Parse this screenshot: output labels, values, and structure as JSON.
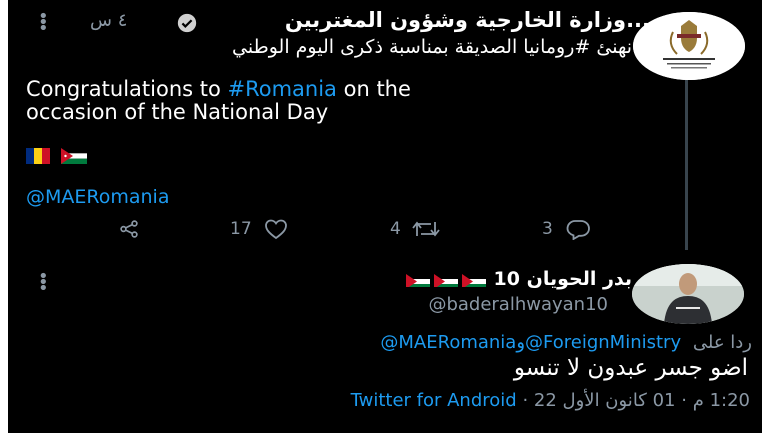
{
  "tweet": {
    "author_name": "...وزارة الخارجية وشؤون المغتربين",
    "timestamp": "٤ س",
    "arabic_text": "نهنئ #رومانيا الصديقة بمناسبة ذكرى اليوم الوطني",
    "english_line1_prefix": "Congratulations to ",
    "english_line1_hashtag": "#Romania",
    "english_line1_suffix": " on the",
    "english_line2": "occasion of the National Day",
    "mention": "@MAERomania",
    "actions": {
      "likes": "17",
      "retweets": "4",
      "replies": "3"
    }
  },
  "reply": {
    "display_name": "بدر الحويان 10",
    "handle": "@baderalhwayan10",
    "replying_prefix": "ردا على",
    "replying_to_1": "@ForeignMinistry",
    "replying_and": "و",
    "replying_to_2": "@MAERomania",
    "text": "اضو جسر عبدون لا تنسو",
    "time": "1:20 م",
    "date": "01 كانون الأول 22",
    "source": "Twitter for Android"
  },
  "colors": {
    "background": "#000000",
    "link": "#1d9bf0",
    "muted": "#8b98a5"
  },
  "icons": [
    "verified-badge-icon",
    "share-icon",
    "like-icon",
    "retweet-icon",
    "reply-icon",
    "more-options-icon"
  ]
}
